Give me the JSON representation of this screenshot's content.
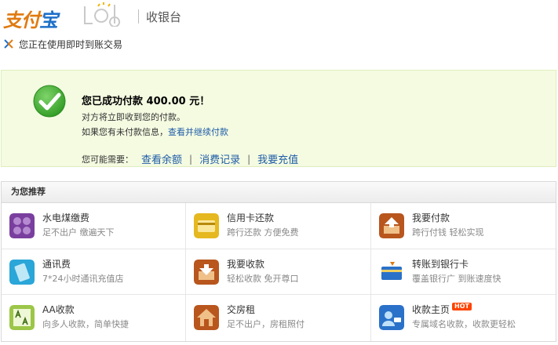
{
  "header": {
    "logo_text_a": "支付",
    "logo_text_b": "宝",
    "lab_text": "lab",
    "title": "收银台"
  },
  "notice": {
    "text": "您正在使用即时到账交易"
  },
  "success": {
    "title": "您已成功付款 400.00 元！",
    "line1": "对方将立即收到您的付款。",
    "line2_prefix": "如果您有未付款信息，",
    "line2_link": "查看并继续付款",
    "more_label": "您可能需要：",
    "links": [
      "查看余额",
      "消费记录",
      "我要充值"
    ],
    "separator": "|"
  },
  "recommend": {
    "title": "为您推荐",
    "items": [
      {
        "title": "水电煤缴费",
        "desc": "足不出户  缴遍天下",
        "icon": "utility-bill-icon"
      },
      {
        "title": "信用卡还款",
        "desc": "跨行还款  方便免费",
        "icon": "credit-card-icon"
      },
      {
        "title": "我要付款",
        "desc": "跨行付钱  轻松实现",
        "icon": "payment-box-icon"
      },
      {
        "title": "通讯费",
        "desc": "7*24小时通讯充值店",
        "icon": "mobile-phone-icon"
      },
      {
        "title": "我要收款",
        "desc": "轻松收款  免开尊口",
        "icon": "collect-box-icon"
      },
      {
        "title": "转账到银行卡",
        "desc": "覆盖银行广  到账速度快",
        "icon": "bank-card-icon"
      },
      {
        "title": "AA收款",
        "desc": "向多人收款，简单快捷",
        "icon": "aa-collect-icon"
      },
      {
        "title": "交房租",
        "desc": "足不出户，房租照付",
        "icon": "rent-house-icon"
      },
      {
        "title": "收款主页",
        "desc": "专属域名收款，收款更轻松",
        "icon": "homepage-icon",
        "badge": "HOT"
      }
    ]
  }
}
